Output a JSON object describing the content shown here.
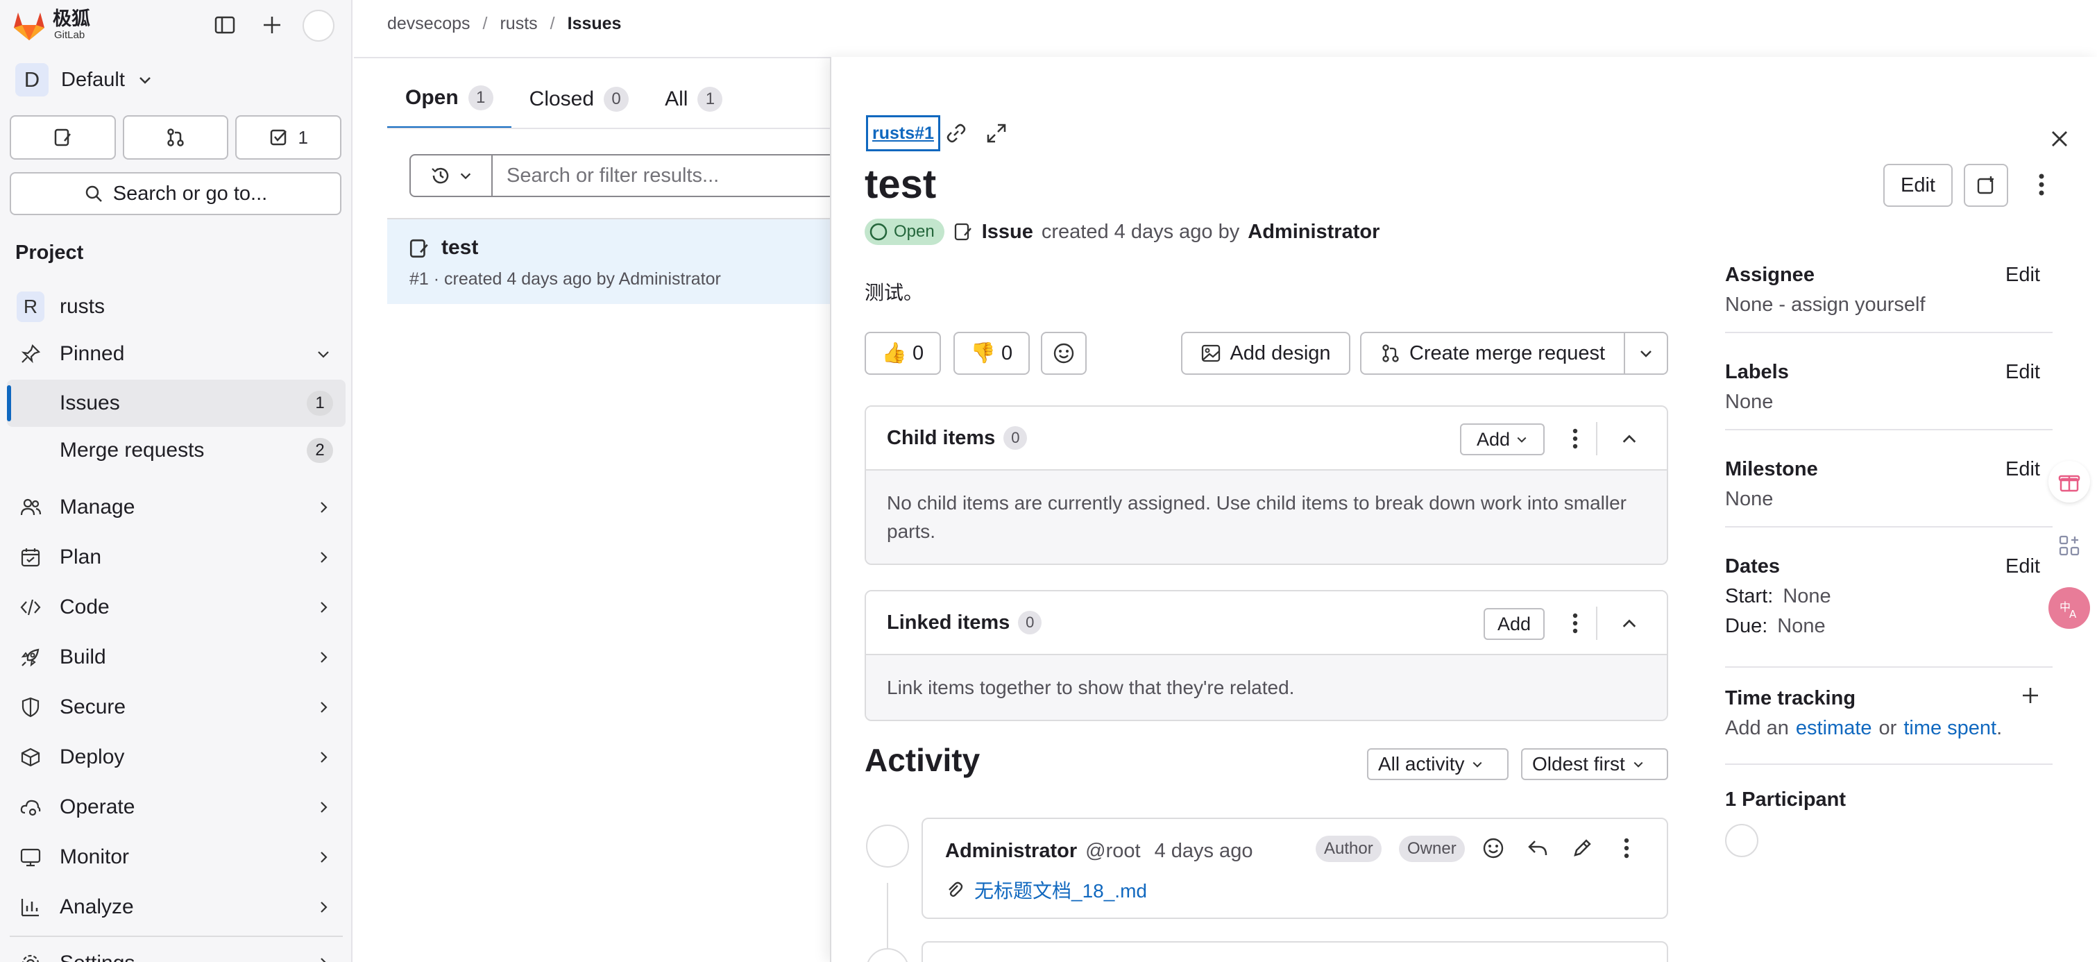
{
  "app": {
    "logo_text": "极狐",
    "logo_sub": "GitLab"
  },
  "sidebar": {
    "org_initial": "D",
    "org_name": "Default",
    "todo_count": "1",
    "search_label": "Search or go to...",
    "section_title": "Project",
    "project_initial": "R",
    "project_name": "rusts",
    "pinned_label": "Pinned",
    "pinned_items": [
      {
        "label": "Issues",
        "count": "1"
      },
      {
        "label": "Merge requests",
        "count": "2"
      }
    ],
    "nav_items": [
      {
        "label": "Manage"
      },
      {
        "label": "Plan"
      },
      {
        "label": "Code"
      },
      {
        "label": "Build"
      },
      {
        "label": "Secure"
      },
      {
        "label": "Deploy"
      },
      {
        "label": "Operate"
      },
      {
        "label": "Monitor"
      },
      {
        "label": "Analyze"
      },
      {
        "label": "Settings"
      }
    ]
  },
  "breadcrumb": [
    "devsecops",
    "rusts",
    "Issues"
  ],
  "tabs": [
    {
      "label": "Open",
      "count": "1"
    },
    {
      "label": "Closed",
      "count": "0"
    },
    {
      "label": "All",
      "count": "1"
    }
  ],
  "filter": {
    "placeholder": "Search or filter results..."
  },
  "issue_list": [
    {
      "title": "test",
      "meta": "#1 · created 4 days ago by Administrator"
    }
  ],
  "drawer": {
    "ref": "rusts#1",
    "title": "test",
    "edit_label": "Edit",
    "status": "Open",
    "meta_type": "Issue",
    "meta_created": "created 4 days ago by",
    "meta_author": "Administrator",
    "description": "测试。",
    "thumbs_up": "👍 0",
    "thumbs_down": "👎 0",
    "add_design": "Add design",
    "create_mr": "Create merge request",
    "child_items": {
      "title": "Child items",
      "count": "0",
      "add_label": "Add",
      "body": "No child items are currently assigned. Use child items to break down work into smaller parts."
    },
    "linked_items": {
      "title": "Linked items",
      "count": "0",
      "add_label": "Add",
      "body": "Link items together to show that they're related."
    },
    "activity": {
      "title": "Activity",
      "filter": "All activity",
      "sort": "Oldest first",
      "note": {
        "author": "Administrator",
        "handle": "@root",
        "time": "4 days ago",
        "roles": [
          "Author",
          "Owner"
        ],
        "file": "无标题文档_18_.md"
      }
    },
    "right": {
      "assignee": {
        "title": "Assignee",
        "edit": "Edit",
        "value": "None - assign yourself"
      },
      "labels": {
        "title": "Labels",
        "edit": "Edit",
        "value": "None"
      },
      "milestone": {
        "title": "Milestone",
        "edit": "Edit",
        "value": "None"
      },
      "dates": {
        "title": "Dates",
        "edit": "Edit",
        "start_label": "Start:",
        "start_value": "None",
        "due_label": "Due:",
        "due_value": "None"
      },
      "time_tracking": {
        "title": "Time tracking",
        "prefix": "Add an",
        "estimate": "estimate",
        "or": "or",
        "spent": "time spent",
        "suffix": "."
      },
      "participants": {
        "title": "1 Participant"
      }
    }
  },
  "colors": {
    "accent": "#1068bf",
    "open_bg": "#c3e6cd",
    "open_fg": "#24663b",
    "sidebar_bg": "#f6f6f8"
  }
}
